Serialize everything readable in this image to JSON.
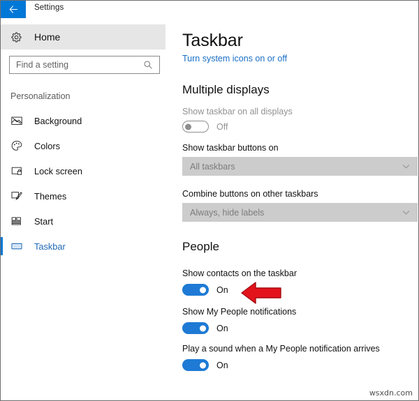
{
  "window": {
    "title": "Settings",
    "back_icon": "back-arrow-icon"
  },
  "sidebar": {
    "home": {
      "label": "Home",
      "icon": "gear-icon"
    },
    "search": {
      "placeholder": "Find a setting",
      "icon": "search-icon"
    },
    "group_title": "Personalization",
    "items": [
      {
        "label": "Background",
        "icon": "picture-icon",
        "selected": false
      },
      {
        "label": "Colors",
        "icon": "palette-icon",
        "selected": false
      },
      {
        "label": "Lock screen",
        "icon": "lock-screen-icon",
        "selected": false
      },
      {
        "label": "Themes",
        "icon": "brush-icon",
        "selected": false
      },
      {
        "label": "Start",
        "icon": "start-grid-icon",
        "selected": false
      },
      {
        "label": "Taskbar",
        "icon": "monitor-icon",
        "selected": true
      }
    ]
  },
  "main": {
    "title": "Taskbar",
    "link": "Turn system icons on or off",
    "sections": [
      {
        "heading": "Multiple displays",
        "settings": {
          "show_taskbar_all_displays": {
            "label": "Show taskbar on all displays",
            "state": "Off",
            "disabled": true
          },
          "show_taskbar_buttons_on": {
            "label": "Show taskbar buttons on",
            "value": "All taskbars",
            "chevron": "chevron-down-icon",
            "disabled": true
          },
          "combine_buttons": {
            "label": "Combine buttons on other taskbars",
            "value": "Always, hide labels",
            "chevron": "chevron-down-icon",
            "disabled": true
          }
        }
      },
      {
        "heading": "People",
        "settings": {
          "show_contacts": {
            "label": "Show contacts on the taskbar",
            "state": "On",
            "disabled": false
          },
          "show_notifications": {
            "label": "Show My People notifications",
            "state": "On",
            "disabled": false
          },
          "play_sound": {
            "label": "Play a sound when a My People notification arrives",
            "state": "On",
            "disabled": false
          }
        }
      }
    ]
  },
  "annotation": {
    "type": "left-pointing-arrow",
    "color": "#e3131c",
    "points_at": "show-contacts-toggle"
  },
  "watermark": "wsxdn.com",
  "colors": {
    "accent": "#0078d7",
    "toggle_on": "#1e7ad4",
    "link": "#1a6fc4",
    "selected_text": "#1e68b5",
    "dropdown_bg": "#cccccc",
    "home_row_bg": "#e6e6e6",
    "annotation_red": "#e3131c"
  }
}
